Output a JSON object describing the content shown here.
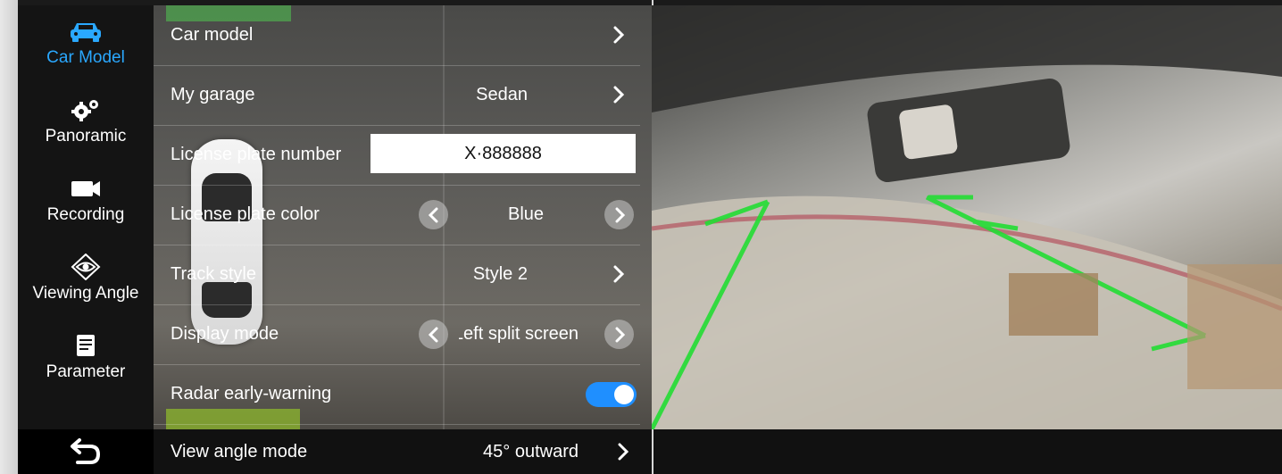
{
  "sidebar": {
    "items": [
      {
        "label": "Car Model",
        "icon": "car-icon",
        "active": true
      },
      {
        "label": "Panoramic",
        "icon": "gears-icon",
        "active": false
      },
      {
        "label": "Recording",
        "icon": "video-camera-icon",
        "active": false
      },
      {
        "label": "Viewing Angle",
        "icon": "eye-diamond-icon",
        "active": false
      },
      {
        "label": "Parameter",
        "icon": "document-icon",
        "active": false
      }
    ],
    "back_icon": "back-arrow-icon"
  },
  "settings": {
    "car_model": {
      "label": "Car model"
    },
    "my_garage": {
      "label": "My garage",
      "value": "Sedan"
    },
    "license_plate_number": {
      "label": "License plate number",
      "value": "X·888888"
    },
    "license_plate_color": {
      "label": "License plate color",
      "value": "Blue"
    },
    "track_style": {
      "label": "Track style",
      "value": "Style 2"
    },
    "display_mode": {
      "label": "Display mode",
      "value": "Left split screen"
    },
    "radar_early_warning": {
      "label": "Radar early-warning",
      "enabled": true
    },
    "view_angle_mode": {
      "label": "View angle mode",
      "value": "45° outward"
    }
  },
  "colors": {
    "accent": "#2aa8ff",
    "toggle_on": "#1f8fff",
    "sidebar_bg": "#141414",
    "guide_line": "#22dd33"
  }
}
